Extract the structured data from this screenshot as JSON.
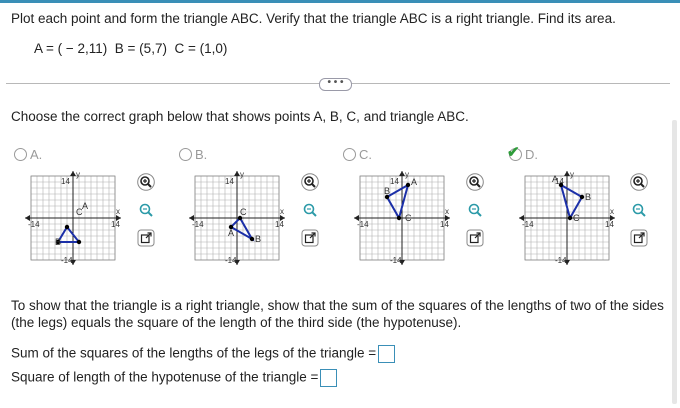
{
  "problem": {
    "prompt": "Plot each point and form the triangle ABC.  Verify that the triangle ABC is a right triangle.  Find its area.",
    "points": "A = ( − 2,11)  B = (5,7)  C = (1,0)"
  },
  "more_button": "• • •",
  "question": "Choose the correct graph below that shows points A, B, C, and triangle ABC.",
  "options": [
    {
      "letter": "A.",
      "selected": false
    },
    {
      "letter": "B.",
      "selected": false
    },
    {
      "letter": "C.",
      "selected": false
    },
    {
      "letter": "D.",
      "selected": true
    }
  ],
  "graph_labels": {
    "neg": "-14",
    "pos": "14",
    "y": "y",
    "x": "x",
    "ntop": "14",
    "nbot": "-14"
  },
  "vertex_labels": {
    "a": "A",
    "b": "B",
    "c": "C"
  },
  "instructions": "To show that the triangle is a right triangle, show that the sum of the squares of the lengths of two of the sides (the legs) equals the square of the length of the third side (the hypotenuse).",
  "answers": {
    "legs_label": "Sum of the squares of the lengths of the legs of the triangle =",
    "hyp_label": "Square of length of the hypotenuse of the triangle ="
  },
  "icons": [
    "zoom-in-icon",
    "zoom-out-icon",
    "expand-icon"
  ],
  "colors": {
    "triangle": "#1b2fa8",
    "grid": "#9a9a9a",
    "check": "#2e9b3a",
    "accent": "#3a8fb7"
  }
}
